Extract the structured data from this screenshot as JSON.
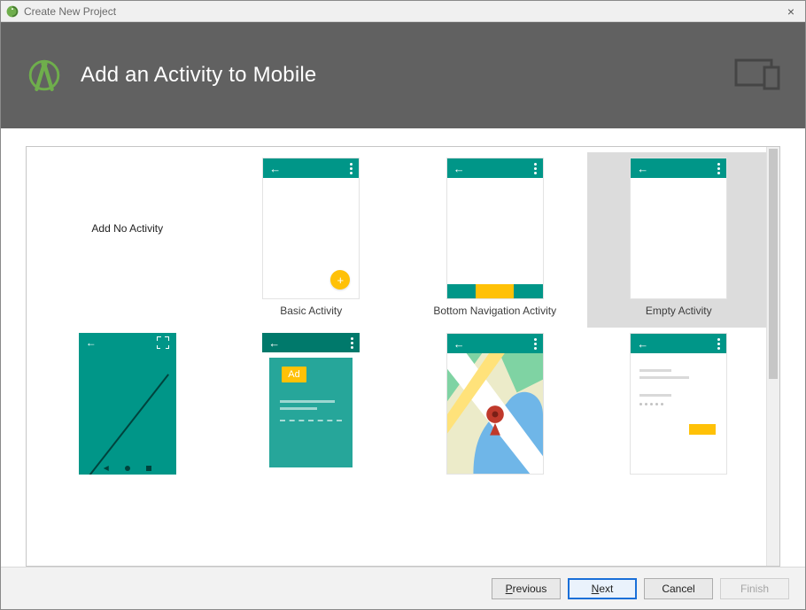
{
  "window": {
    "title": "Create New Project",
    "close_glyph": "×"
  },
  "header": {
    "title": "Add an Activity to Mobile"
  },
  "activities": [
    {
      "id": "none",
      "label": "Add No Activity",
      "kind": "none",
      "selected": false
    },
    {
      "id": "basic",
      "label": "Basic Activity",
      "kind": "basic",
      "selected": false
    },
    {
      "id": "bottom",
      "label": "Bottom Navigation Activity",
      "kind": "bottomnav",
      "selected": false
    },
    {
      "id": "empty",
      "label": "Empty Activity",
      "kind": "empty",
      "selected": true
    },
    {
      "id": "full",
      "label": "",
      "kind": "fullscreen",
      "selected": false
    },
    {
      "id": "admob",
      "label": "",
      "kind": "admob",
      "selected": false
    },
    {
      "id": "maps",
      "label": "",
      "kind": "maps",
      "selected": false
    },
    {
      "id": "login",
      "label": "",
      "kind": "login",
      "selected": false
    }
  ],
  "admob": {
    "ad_badge": "Ad"
  },
  "footer": {
    "previous": "Previous",
    "next": "Next",
    "cancel": "Cancel",
    "finish": "Finish"
  }
}
